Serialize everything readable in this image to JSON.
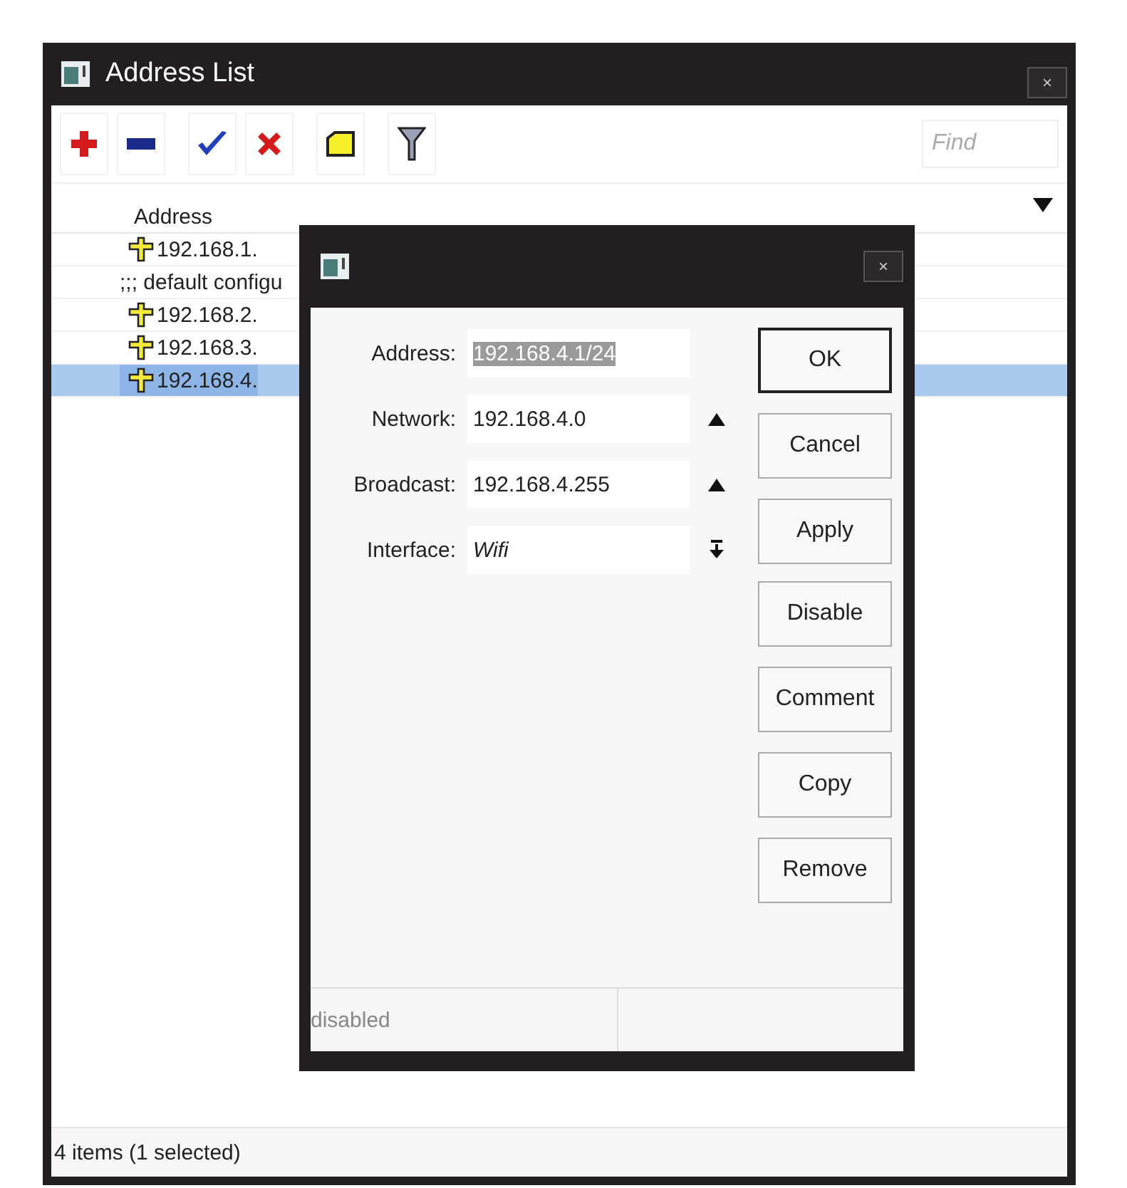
{
  "window": {
    "title": "Address List",
    "close": "×"
  },
  "search": {
    "placeholder": "Find"
  },
  "table": {
    "columns": [
      {
        "label": "Address"
      }
    ],
    "rows": [
      {
        "kind": "address",
        "text": "192.168.1.",
        "selected": false
      },
      {
        "kind": "comment",
        "text": ";;; default configu",
        "selected": false
      },
      {
        "kind": "address",
        "text": "192.168.2.",
        "selected": false
      },
      {
        "kind": "address",
        "text": "192.168.3.",
        "selected": false
      },
      {
        "kind": "address",
        "text": "192.168.4.",
        "selected": true
      }
    ]
  },
  "status_bar": "4 items (1 selected)",
  "dialog": {
    "close": "×",
    "fields": [
      {
        "label": "Address:",
        "value": "192.168.4.1/24",
        "selected": true,
        "kind": "plain"
      },
      {
        "label": "Network:",
        "value": "192.168.4.0",
        "selected": false,
        "kind": "collapse"
      },
      {
        "label": "Broadcast:",
        "value": "192.168.4.255",
        "selected": false,
        "kind": "collapse"
      },
      {
        "label": "Interface:",
        "value": "Wifi",
        "selected": false,
        "kind": "dropdown"
      }
    ],
    "button_groups": [
      [
        {
          "label": "OK",
          "default": true
        },
        {
          "label": "Cancel",
          "default": false
        },
        {
          "label": "Apply",
          "default": false
        }
      ],
      [
        {
          "label": "Disable",
          "default": false
        },
        {
          "label": "Comment",
          "default": false
        },
        {
          "label": "Copy",
          "default": false
        },
        {
          "label": "Remove",
          "default": false
        }
      ]
    ],
    "status": "disabled"
  }
}
